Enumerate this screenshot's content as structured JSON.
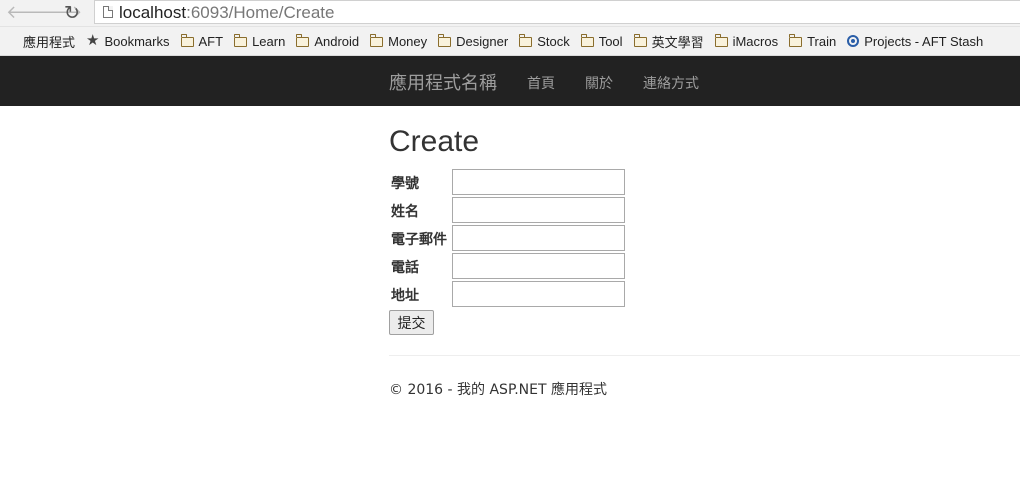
{
  "browser": {
    "url_host": "localhost",
    "url_rest": ":6093/Home/Create",
    "bookmarks": [
      {
        "label": "應用程式",
        "icon": "apps-icon"
      },
      {
        "label": "Bookmarks",
        "icon": "star-icon"
      },
      {
        "label": "AFT",
        "icon": "folder-icon"
      },
      {
        "label": "Learn",
        "icon": "folder-icon"
      },
      {
        "label": "Android",
        "icon": "folder-icon"
      },
      {
        "label": "Money",
        "icon": "folder-icon"
      },
      {
        "label": "Designer",
        "icon": "folder-icon"
      },
      {
        "label": "Stock",
        "icon": "folder-icon"
      },
      {
        "label": "Tool",
        "icon": "folder-icon"
      },
      {
        "label": "英文學習",
        "icon": "folder-icon"
      },
      {
        "label": "iMacros",
        "icon": "folder-icon"
      },
      {
        "label": "Train",
        "icon": "folder-icon"
      },
      {
        "label": "Projects - AFT Stash",
        "icon": "stash-icon"
      }
    ]
  },
  "navbar": {
    "brand": "應用程式名稱",
    "links": [
      "首頁",
      "關於",
      "連絡方式"
    ]
  },
  "page": {
    "title": "Create",
    "fields": [
      {
        "label": "學號",
        "value": ""
      },
      {
        "label": "姓名",
        "value": ""
      },
      {
        "label": "電子郵件",
        "value": ""
      },
      {
        "label": "電話",
        "value": ""
      },
      {
        "label": "地址",
        "value": ""
      }
    ],
    "submit_label": "提交"
  },
  "footer": {
    "text": "© 2016 - 我的 ASP.NET 應用程式"
  }
}
